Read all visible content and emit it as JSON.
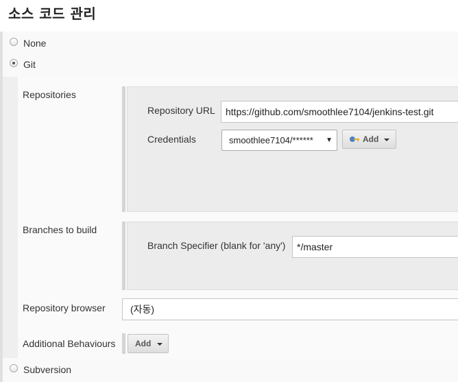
{
  "section_title": "소스 코드 관리",
  "scm_options": {
    "none": "None",
    "git": "Git",
    "subversion": "Subversion"
  },
  "selected_scm": "Git",
  "repositories": {
    "label": "Repositories",
    "url_label": "Repository URL",
    "url_value": "https://github.com/smoothlee7104/jenkins-test.git",
    "credentials_label": "Credentials",
    "credentials_value": "smoothlee7104/******",
    "add_label": "Add"
  },
  "branches": {
    "label": "Branches to build",
    "specifier_label": "Branch Specifier (blank for 'any')",
    "specifier_value": "*/master"
  },
  "repository_browser": {
    "label": "Repository browser",
    "value": "(자동)"
  },
  "additional_behaviours": {
    "label": "Additional Behaviours",
    "add_label": "Add"
  },
  "icons": {
    "add_credential": "key-icon",
    "dropdown": "caret-down-icon"
  },
  "colors": {
    "panel_background": "#ececec",
    "section_bar": "#d4d4d4",
    "text": "#333333"
  }
}
